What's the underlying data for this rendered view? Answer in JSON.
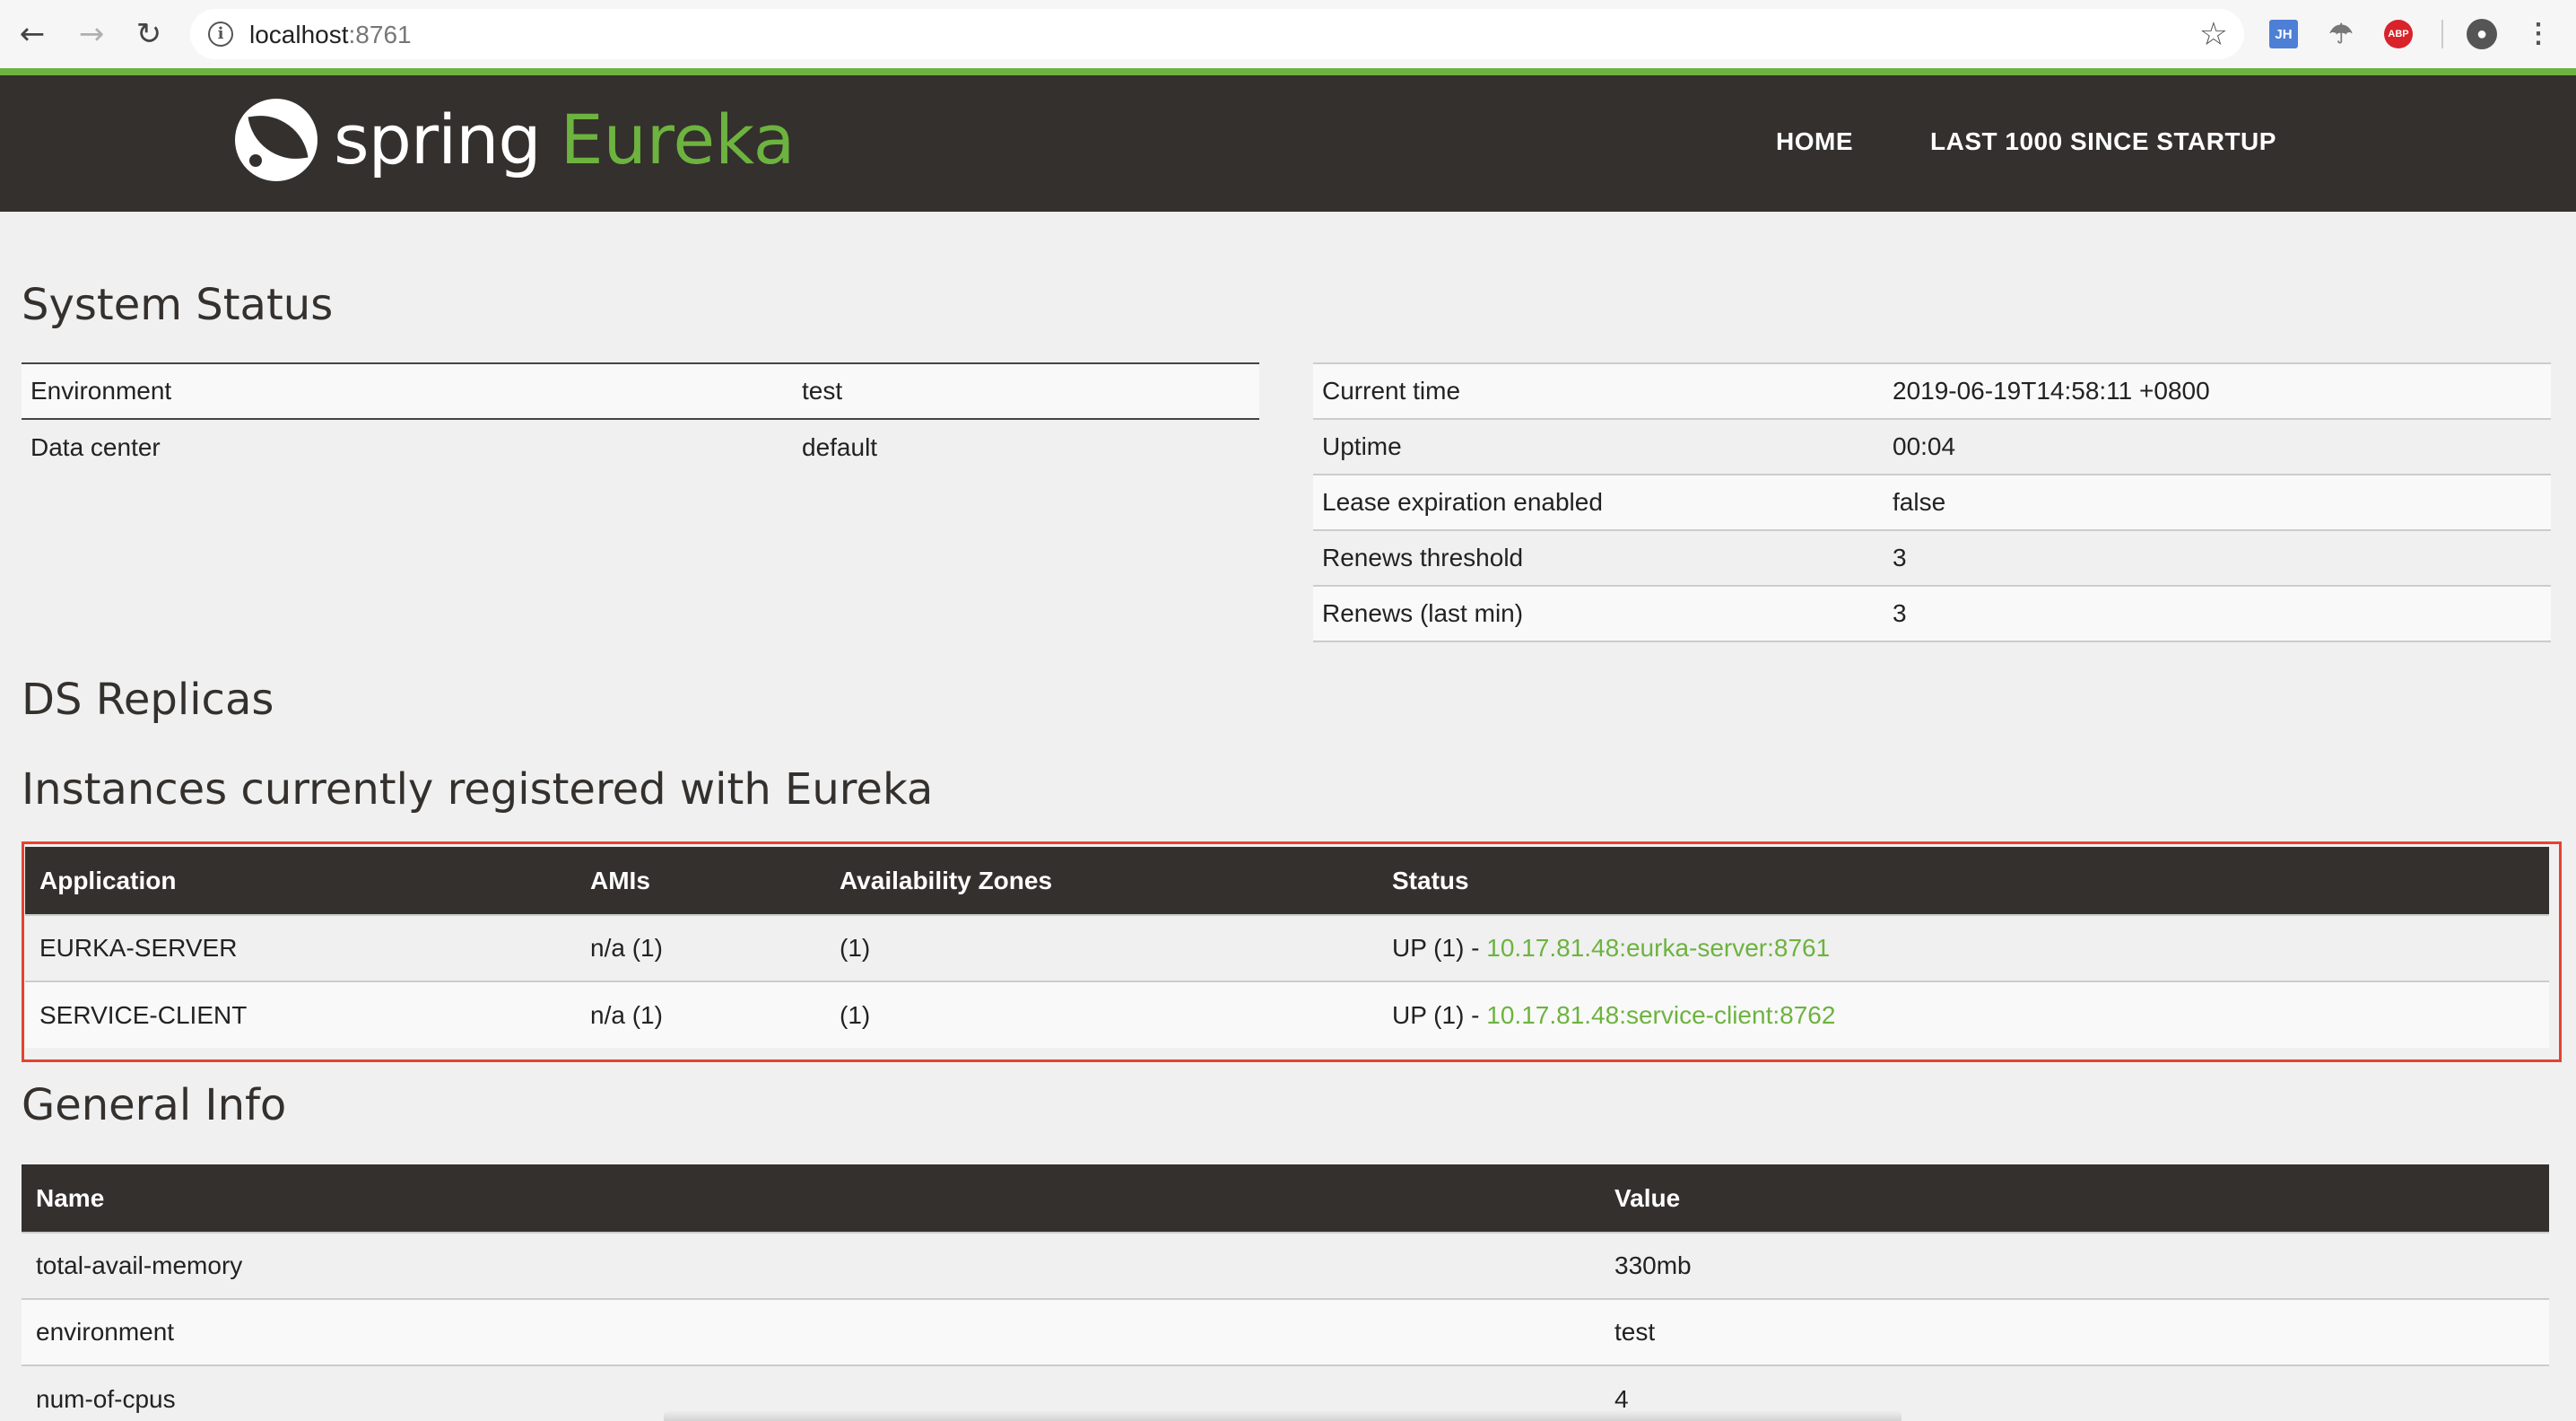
{
  "browser": {
    "url_host": "localhost",
    "url_port": ":8761",
    "icons": {
      "back": "back-arrow-icon",
      "forward": "forward-arrow-icon",
      "reload": "reload-icon",
      "info": "info-icon",
      "star": "star-icon",
      "jh": "JH",
      "abp": "ABP"
    }
  },
  "navbar": {
    "logo_spring": "spring",
    "logo_eureka": "Eureka",
    "links": [
      "HOME",
      "LAST 1000 SINCE STARTUP"
    ],
    "accent": "#6db33f",
    "background": "#34302d"
  },
  "system_status": {
    "title": "System Status",
    "left": [
      {
        "label": "Environment",
        "value": "test"
      },
      {
        "label": "Data center",
        "value": "default"
      }
    ],
    "right": [
      {
        "label": "Current time",
        "value": "2019-06-19T14:58:11 +0800"
      },
      {
        "label": "Uptime",
        "value": "00:04"
      },
      {
        "label": "Lease expiration enabled",
        "value": "false"
      },
      {
        "label": "Renews threshold",
        "value": "3"
      },
      {
        "label": "Renews (last min)",
        "value": "3"
      }
    ]
  },
  "ds_replicas": {
    "title": "DS Replicas"
  },
  "instances": {
    "title": "Instances currently registered with Eureka",
    "columns": [
      "Application",
      "AMIs",
      "Availability Zones",
      "Status"
    ],
    "rows": [
      {
        "application": "EURKA-SERVER",
        "amis": "n/a (1)",
        "zones": "(1)",
        "status_prefix": "UP (1) - ",
        "status_link": "10.17.81.48:eurka-server:8761"
      },
      {
        "application": "SERVICE-CLIENT",
        "amis": "n/a (1)",
        "zones": "(1)",
        "status_prefix": "UP (1) - ",
        "status_link": "10.17.81.48:service-client:8762"
      }
    ],
    "highlight_color": "#e5432e"
  },
  "general_info": {
    "title": "General Info",
    "columns": [
      "Name",
      "Value"
    ],
    "rows": [
      {
        "name": "total-avail-memory",
        "value": "330mb"
      },
      {
        "name": "environment",
        "value": "test"
      },
      {
        "name": "num-of-cpus",
        "value": "4"
      }
    ]
  }
}
